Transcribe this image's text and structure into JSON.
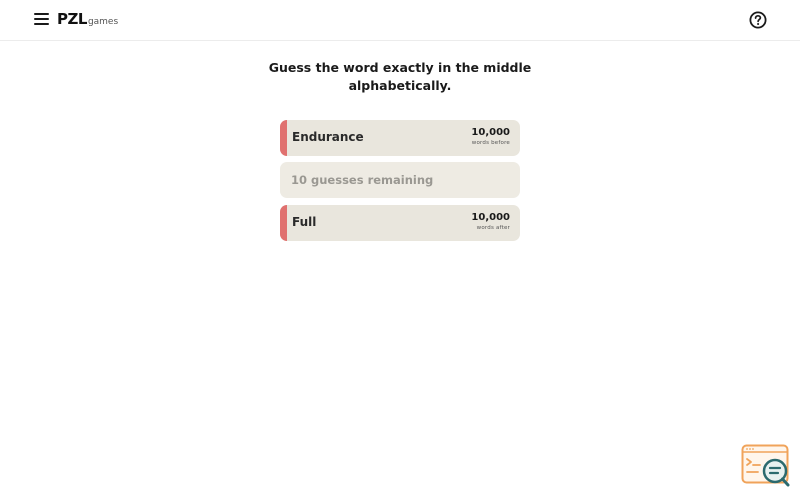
{
  "header": {
    "logo_main": "PZL",
    "logo_sub": "games",
    "menu_icon": "menu-icon",
    "help_icon": "help-icon"
  },
  "instructions": {
    "line1": "Guess the word exactly in the middle",
    "line2": "alphabetically."
  },
  "upper_bound": {
    "word": "Endurance",
    "count": "10,000",
    "caption": "words before"
  },
  "guess": {
    "placeholder": "10 guesses remaining",
    "value": ""
  },
  "lower_bound": {
    "word": "Full",
    "count": "10,000",
    "caption": "words after"
  },
  "colors": {
    "accent": "#e0716f",
    "card_bg": "#e9e6dd",
    "feedback_orange": "#f0a35a",
    "feedback_teal": "#2b6a6e"
  }
}
